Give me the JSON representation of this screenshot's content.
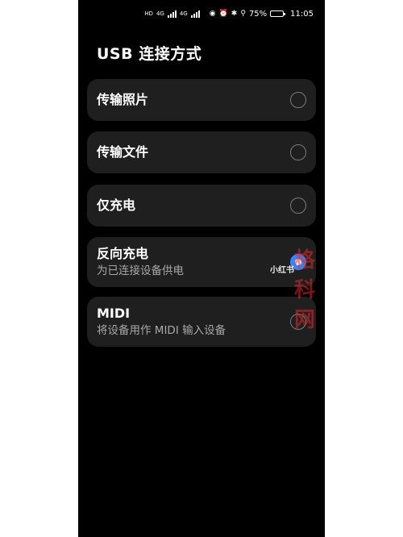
{
  "status_bar": {
    "hd1": "HD",
    "net1": "4G",
    "net2": "4G",
    "eye_icon": "eye-icon",
    "alarm_icon": "alarm-icon",
    "bluetooth_icon": "bluetooth-icon",
    "location_icon": "location-icon",
    "battery_percent": "75%",
    "battery_level": 0.75,
    "time": "11:05"
  },
  "page": {
    "title": "USB 连接方式"
  },
  "options": [
    {
      "label": "传输照片",
      "sub": "",
      "checked": false
    },
    {
      "label": "传输文件",
      "sub": "",
      "checked": false
    },
    {
      "label": "仅充电",
      "sub": "",
      "checked": false
    },
    {
      "label": "反向充电",
      "sub": "为已连接设备供电",
      "checked": true
    },
    {
      "label": "MIDI",
      "sub": "将设备用作 MIDI 输入设备",
      "checked": false
    }
  ],
  "watermarks": {
    "site": "格科网",
    "xhs": "小红书"
  },
  "colors": {
    "background": "#000000",
    "card": "#1f1f1f",
    "accent": "#3b82f6"
  }
}
